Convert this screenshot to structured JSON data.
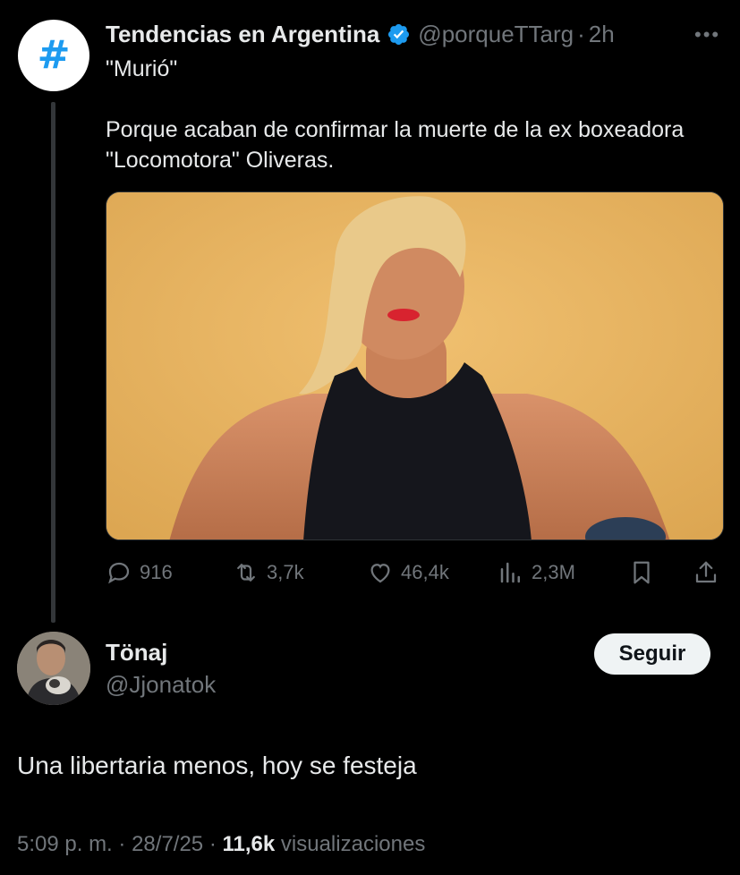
{
  "colors": {
    "background": "#000000",
    "accent": "#1d9bf0",
    "muted": "#71767b",
    "text": "#e7e9ea"
  },
  "tweet": {
    "avatar_symbol": "#",
    "author_name": "Tendencias en Argentina",
    "verified_icon": "verified-badge-icon",
    "handle": "@porqueTTarg",
    "separator": "·",
    "time_ago": "2h",
    "more_label": "•••",
    "text_line_1": "\"Murió\"",
    "text_line_2": "Porque acaban de confirmar la muerte de la ex boxeadora \"Locomotora\" Oliveras.",
    "actions": {
      "replies": "916",
      "retweets": "3,7k",
      "likes": "46,4k",
      "views": "2,3M"
    }
  },
  "reply": {
    "author_name": "Tönaj",
    "handle": "@Jjonatok",
    "follow_label": "Seguir",
    "text": "Una libertaria menos, hoy se festeja",
    "time": "5:09 p. m.",
    "date": "28/7/25",
    "separator": "·",
    "views_count": "11,6k",
    "views_label": "visualizaciones"
  }
}
